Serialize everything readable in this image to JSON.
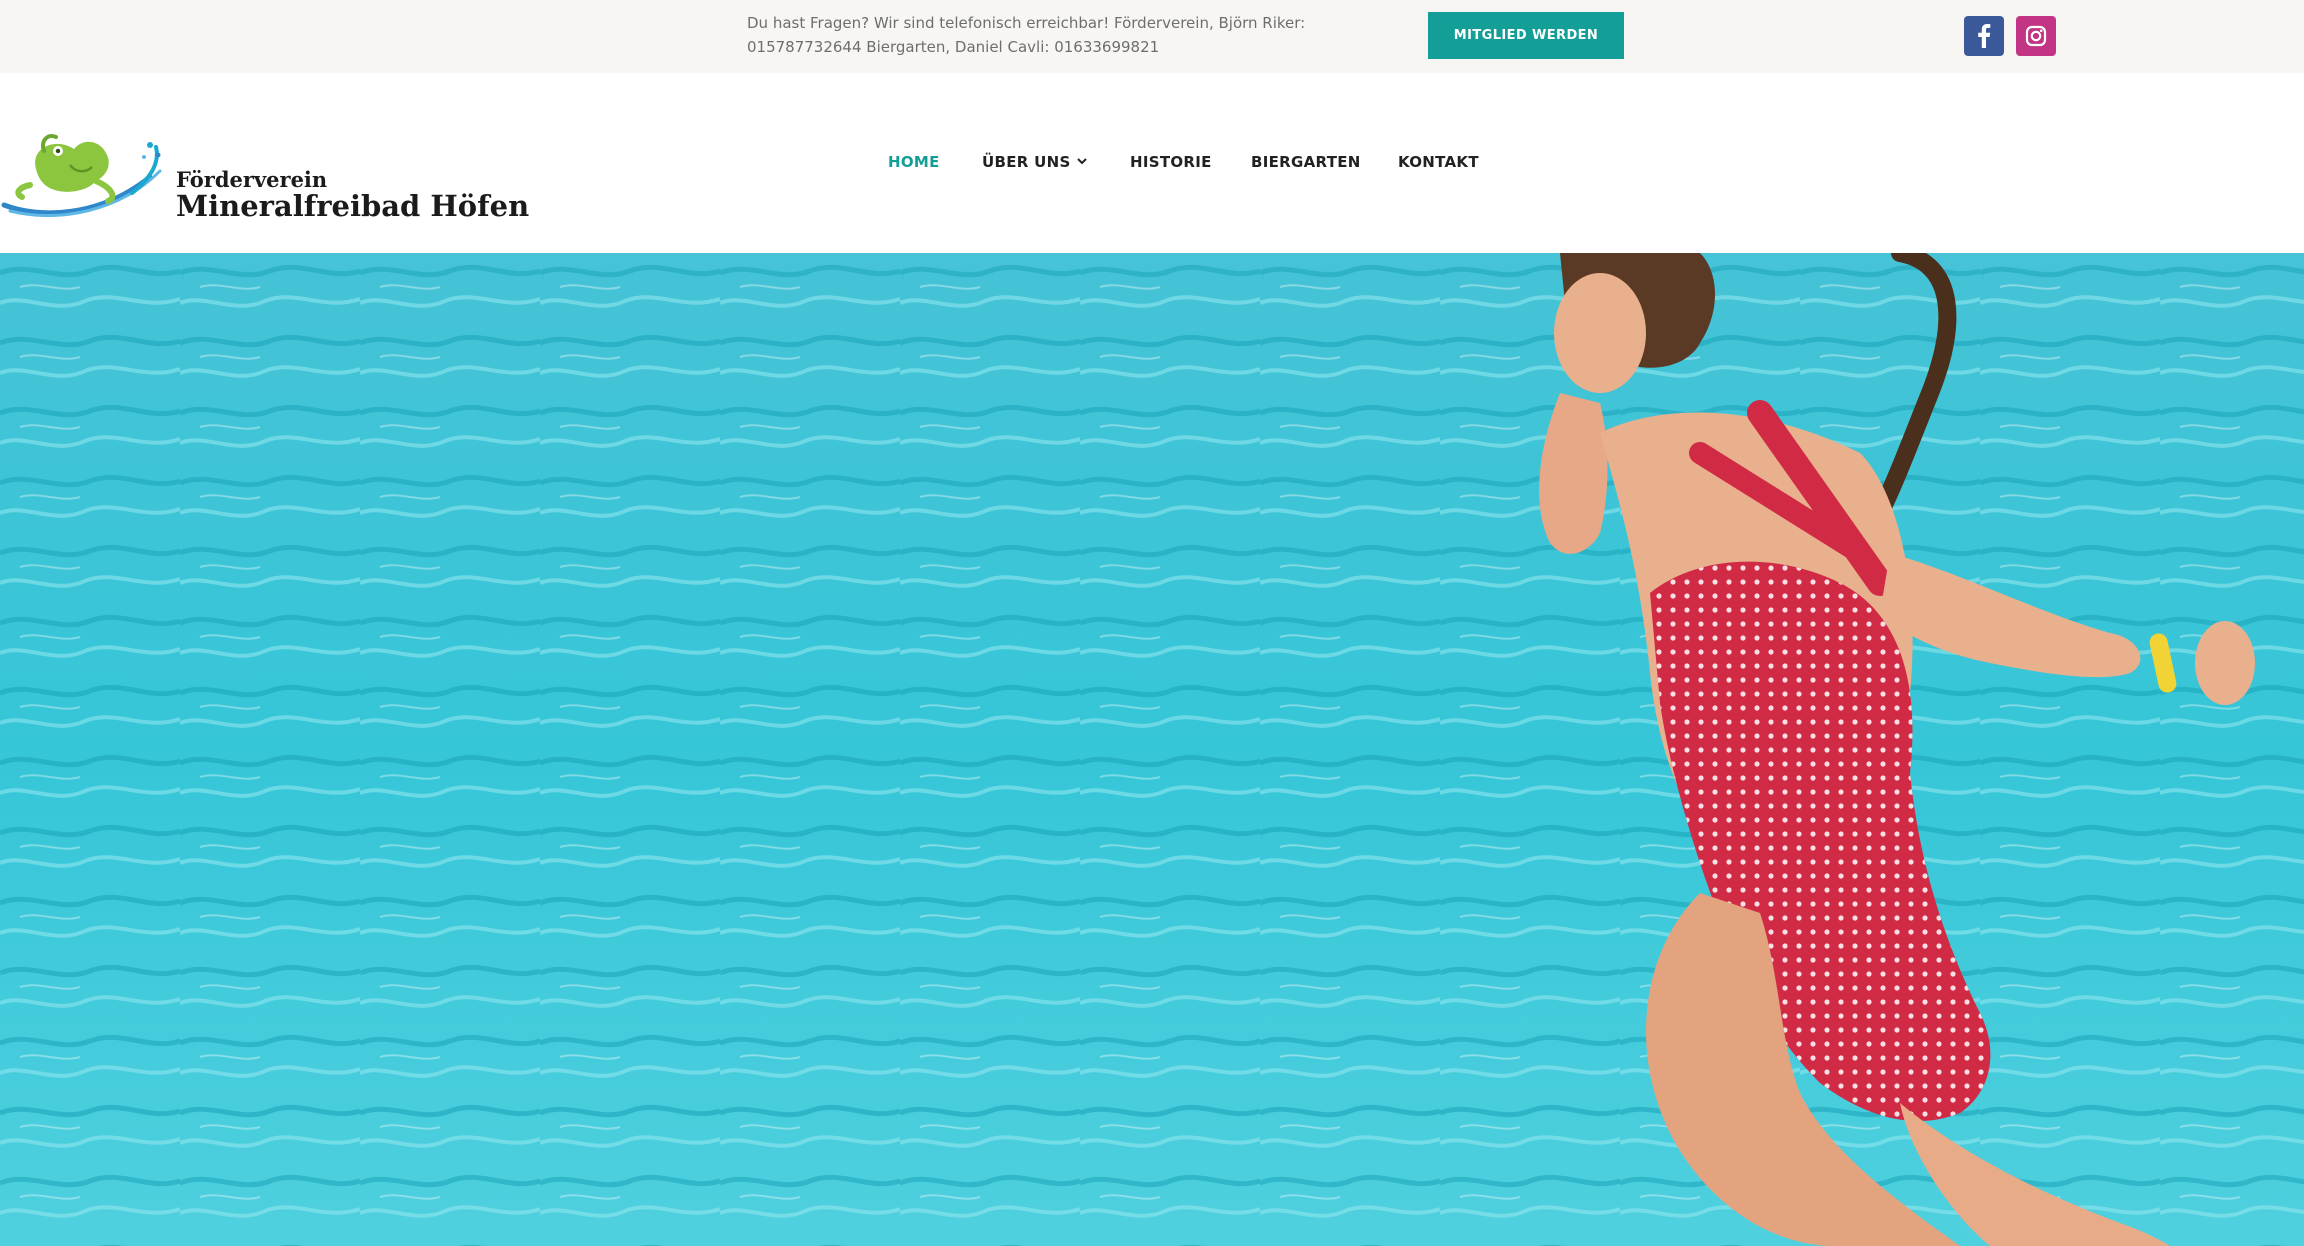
{
  "topbar": {
    "contact_line1": "Du hast Fragen? Wir sind telefonisch erreichbar!  Förderverein, Björn Riker:",
    "contact_line2": "015787732644 Biergarten, Daniel Cavli: 01633699821",
    "cta_label": "MITGLIED WERDEN",
    "social": [
      {
        "name": "facebook",
        "icon": "facebook-icon",
        "color": "#3b5998"
      },
      {
        "name": "instagram",
        "icon": "instagram-icon",
        "color": "#c13584"
      }
    ]
  },
  "logo": {
    "line1": "Förderverein",
    "line2": "Mineralfreibad Höfen",
    "icon": "frog-logo-icon"
  },
  "nav": {
    "items": [
      {
        "label": "HOME",
        "active": true
      },
      {
        "label": "ÜBER UNS",
        "has_dropdown": true
      },
      {
        "label": "HISTORIE"
      },
      {
        "label": "BIERGARTEN"
      },
      {
        "label": "KONTAKT"
      }
    ]
  },
  "hero": {
    "image": "girl-jumping-into-pool-image"
  },
  "colors": {
    "accent": "#139e97",
    "topbar_bg": "#f7f6f3",
    "facebook": "#3b5998",
    "instagram": "#c13584",
    "water": "#3cc8d8"
  }
}
